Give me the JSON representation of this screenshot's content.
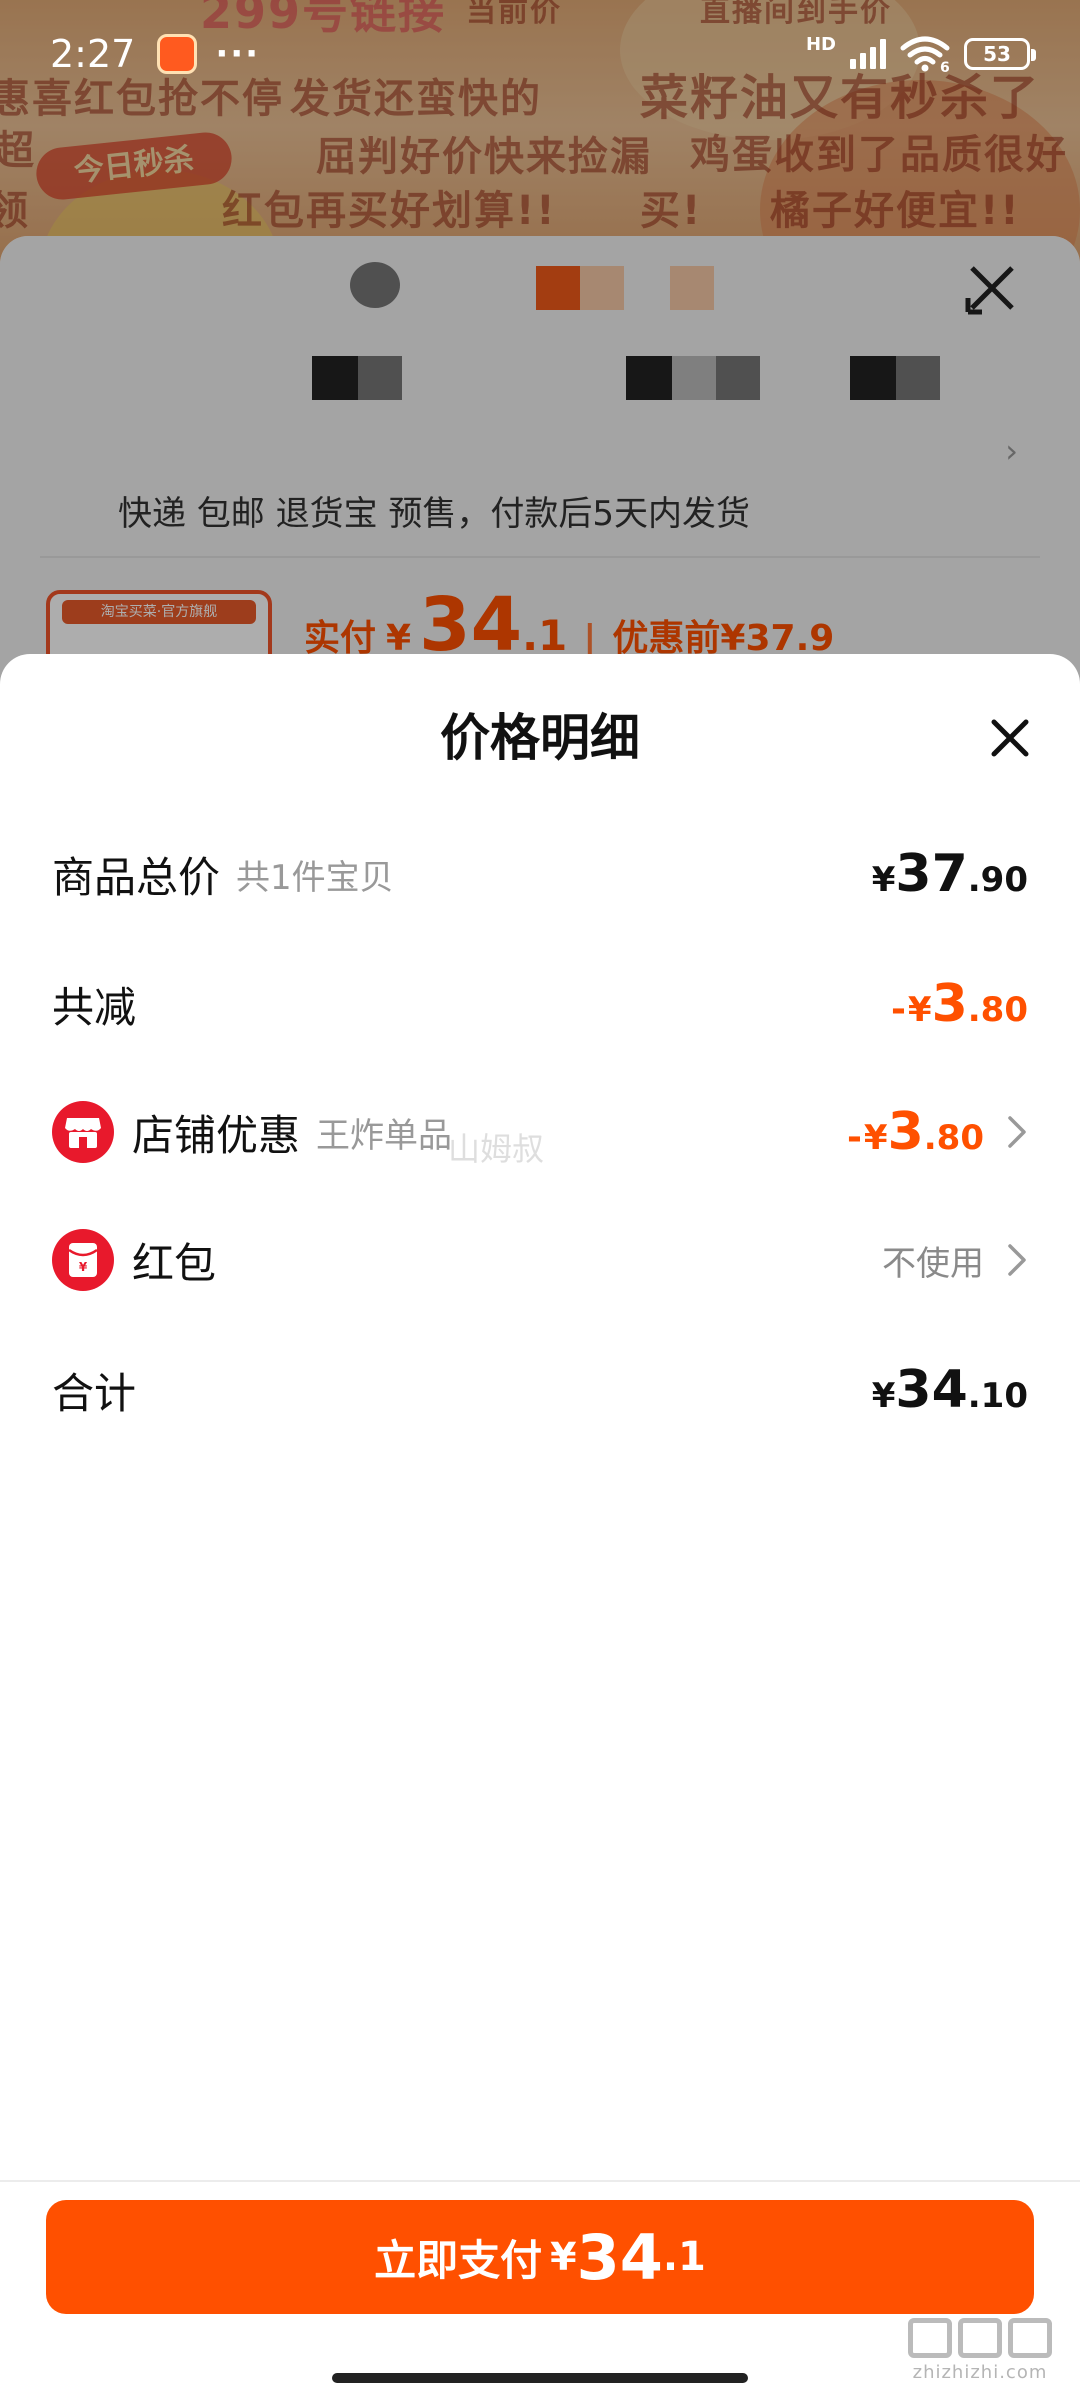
{
  "status_bar": {
    "time": "2:27",
    "dots": "···",
    "network_label": "HD",
    "wifi_badge": "6",
    "battery_level": "53"
  },
  "background": {
    "badge_text": "今日秒杀",
    "banner_top_1": "299号链接",
    "banner_top_2": "当前价",
    "banner_top_3": "直播间到手价",
    "banner_1": "惠喜红包抢不停",
    "banner_2": "发货还蛮快的",
    "banner_3": "菜籽油又有秒杀了",
    "banner_4": "超",
    "banner_5": "屈判好价快来捡漏",
    "banner_6": "鸡蛋收到了品质很好",
    "banner_7": "领",
    "banner_8": "红包再买好划算!!",
    "banner_9": "买!",
    "banner_10": "橘子好便宜!!"
  },
  "order_sheet": {
    "shipping_info": "快递 包邮 退货宝 预售，付款后5天内发货",
    "product_tag": "淘宝买菜·官方旗舰",
    "price_label": "实付",
    "currency": "¥",
    "price_int": "34",
    "price_dec": ".1",
    "separator": "|",
    "before_label": "优惠前",
    "before_price": "¥37.9"
  },
  "price_detail": {
    "title": "价格明细",
    "rows": {
      "total": {
        "label": "商品总价",
        "sub": "共1件宝贝",
        "currency": "¥",
        "int": "37",
        "dec": ".90"
      },
      "reduced": {
        "label": "共减",
        "sign": "-",
        "currency": "¥",
        "int": "3",
        "dec": ".80",
        "color": "#ff5000"
      },
      "shop_discount": {
        "icon": "store-icon",
        "label": "店铺优惠",
        "sub": "王炸单品",
        "sign": "-",
        "currency": "¥",
        "int": "3",
        "dec": ".80"
      },
      "red_packet": {
        "icon": "red-packet-icon",
        "label": "红包",
        "value": "不使用"
      },
      "sum": {
        "label": "合计",
        "currency": "¥",
        "int": "34",
        "dec": ".10"
      }
    },
    "watermark": "山姆叔"
  },
  "pay_button": {
    "label": "立即支付",
    "currency": "¥",
    "int": "34",
    "dec": ".1",
    "color": "#ff5000"
  },
  "watermark_logo": {
    "site": "zhizhizhi.com"
  }
}
